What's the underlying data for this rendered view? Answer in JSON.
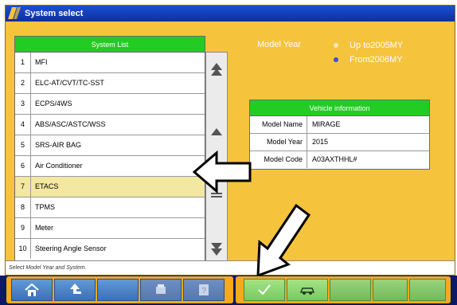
{
  "window": {
    "title": "System select",
    "status_text": "Select Model Year and System."
  },
  "system_list": {
    "header": "System List",
    "items": [
      {
        "num": "1",
        "label": "MFI"
      },
      {
        "num": "2",
        "label": "ELC-AT/CVT/TC-SST"
      },
      {
        "num": "3",
        "label": "ECPS/4WS"
      },
      {
        "num": "4",
        "label": "ABS/ASC/ASTC/WSS"
      },
      {
        "num": "5",
        "label": "SRS-AIR BAG"
      },
      {
        "num": "6",
        "label": "Air Conditioner"
      },
      {
        "num": "7",
        "label": "ETACS"
      },
      {
        "num": "8",
        "label": "TPMS"
      },
      {
        "num": "9",
        "label": "Meter"
      },
      {
        "num": "10",
        "label": "Steering Angle Sensor"
      }
    ],
    "selected_num": "7"
  },
  "model_year": {
    "label": "Model Year",
    "options": [
      {
        "label": "Up to2005MY",
        "selected": false
      },
      {
        "label": "From2006MY",
        "selected": true
      }
    ]
  },
  "vehicle_info": {
    "header": "Vehicle information",
    "rows": [
      {
        "key": "Model Name",
        "value": "MIRAGE"
      },
      {
        "key": "Model Year",
        "value": "2015"
      },
      {
        "key": "Model Code",
        "value": "A03AXTHHL#"
      }
    ]
  },
  "toolbar": {
    "buttons": [
      "home-icon",
      "back-icon",
      "print-icon",
      "help-icon",
      "check-icon",
      "car-icon"
    ]
  },
  "colors": {
    "window_bg": "#f6c33d",
    "header_green": "#22cc22",
    "selected_row": "#f3e7a2",
    "titlebar_blue": "#0a2fa2",
    "toolbar_navy": "#0d1866",
    "toolbar_orange": "#f6a91d",
    "radio_unselected": "#f7e9b0",
    "radio_selected": "#3a4fd6"
  }
}
